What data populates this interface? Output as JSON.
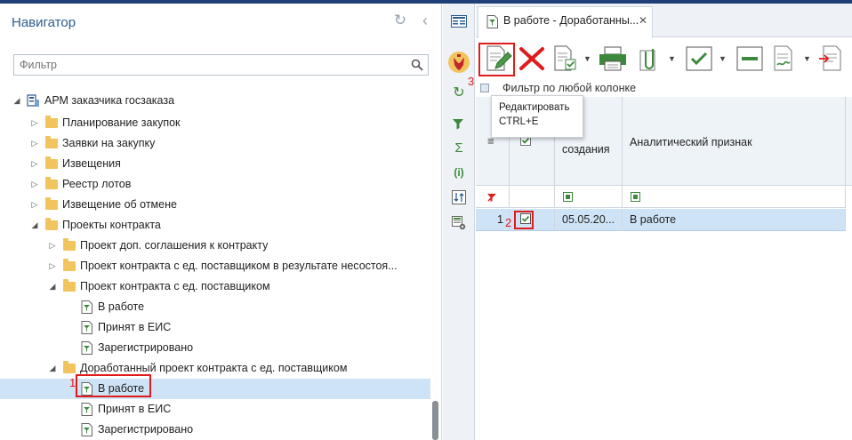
{
  "navigator": {
    "title": "Навигатор",
    "filter_placeholder": "Фильтр"
  },
  "tree": [
    {
      "label": "АРМ заказчика госзаказа",
      "indent": 0,
      "expanded": true,
      "type": "root"
    },
    {
      "label": "Планирование закупок",
      "indent": 1,
      "expanded": false,
      "type": "folder"
    },
    {
      "label": "Заявки на закупку",
      "indent": 1,
      "expanded": false,
      "type": "folder"
    },
    {
      "label": "Извещения",
      "indent": 1,
      "expanded": false,
      "type": "folder"
    },
    {
      "label": "Реестр лотов",
      "indent": 1,
      "expanded": false,
      "type": "folder"
    },
    {
      "label": "Извещение об отмене",
      "indent": 1,
      "expanded": false,
      "type": "folder"
    },
    {
      "label": "Проекты контракта",
      "indent": 1,
      "expanded": true,
      "type": "folder"
    },
    {
      "label": "Проект доп. соглашения к контракту",
      "indent": 2,
      "expanded": false,
      "type": "folder"
    },
    {
      "label": "Проект контракта с ед. поставщиком в результате несостоя...",
      "indent": 2,
      "expanded": false,
      "type": "folder"
    },
    {
      "label": "Проект контракта с ед. поставщиком",
      "indent": 2,
      "expanded": true,
      "type": "folder"
    },
    {
      "label": "В работе",
      "indent": 3,
      "type": "doc"
    },
    {
      "label": "Принят в ЕИС",
      "indent": 3,
      "type": "doc"
    },
    {
      "label": "Зарегистрировано",
      "indent": 3,
      "type": "doc"
    },
    {
      "label": "Доработанный проект контракта с ед. поставщиком",
      "indent": 2,
      "expanded": true,
      "type": "folder"
    },
    {
      "label": "В работе",
      "indent": 3,
      "type": "doc",
      "selected": true
    },
    {
      "label": "Принят в ЕИС",
      "indent": 3,
      "type": "doc"
    },
    {
      "label": "Зарегистрировано",
      "indent": 3,
      "type": "doc"
    }
  ],
  "tab": {
    "label": "В работе - Доработанны...",
    "close": "✕"
  },
  "filter_line": "Фильтр по любой колонке",
  "tooltip": {
    "title": "Редактировать",
    "shortcut": "CTRL+E"
  },
  "grid": {
    "col_date_header": "...\nсоздания",
    "col_date_header_line1": "...",
    "col_date_header_line2": "создания",
    "col_attr_header": "Аналитический признак",
    "rows": [
      {
        "num": "1",
        "date": "05.05.20...",
        "attr": "В работе"
      }
    ]
  },
  "annotations": {
    "mark1": "1",
    "mark2": "2",
    "mark3": "3"
  },
  "colors": {
    "accent": "#2a5d93",
    "selection": "#cfe3f6",
    "highlight": "#e01b1b"
  }
}
